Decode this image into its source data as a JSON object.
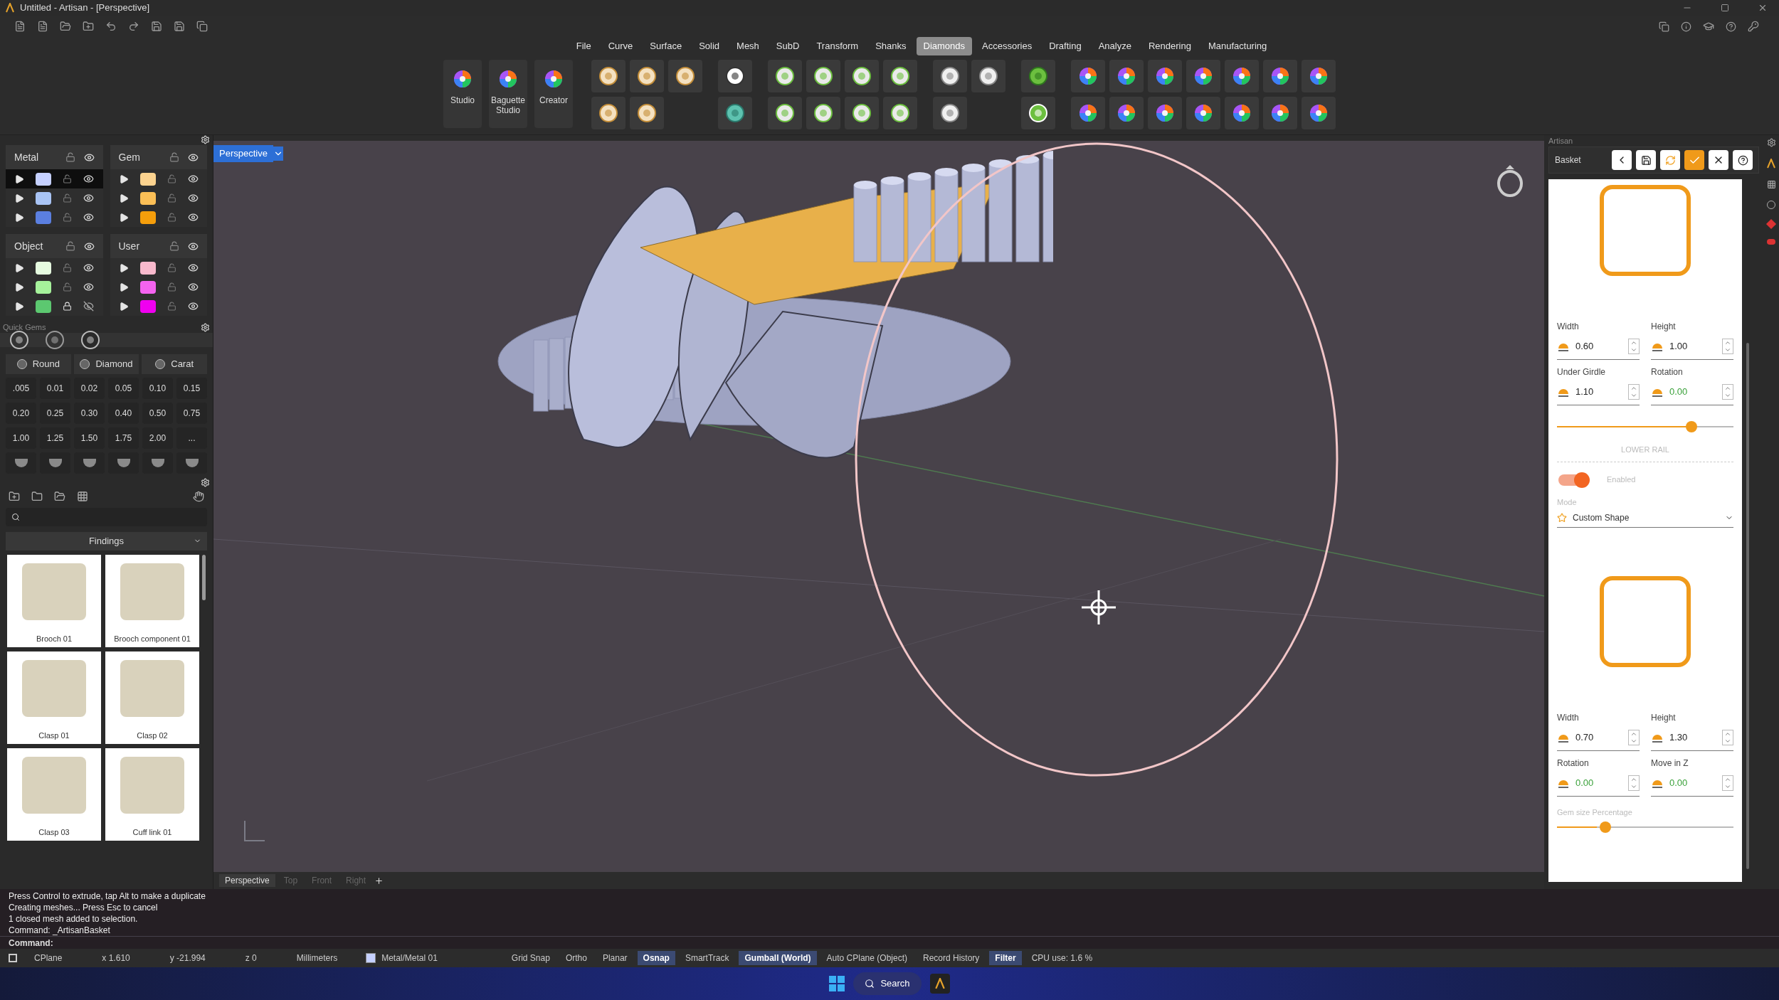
{
  "window": {
    "title": "Untitled - Artisan - [Perspective]"
  },
  "menu": [
    {
      "label": "File",
      "selected": false
    },
    {
      "label": "Curve",
      "selected": false
    },
    {
      "label": "Surface",
      "selected": false
    },
    {
      "label": "Solid",
      "selected": false
    },
    {
      "label": "Mesh",
      "selected": false
    },
    {
      "label": "SubD",
      "selected": false
    },
    {
      "label": "Transform",
      "selected": false
    },
    {
      "label": "Shanks",
      "selected": false
    },
    {
      "label": "Diamonds",
      "selected": true
    },
    {
      "label": "Accessories",
      "selected": false
    },
    {
      "label": "Drafting",
      "selected": false
    },
    {
      "label": "Analyze",
      "selected": false
    },
    {
      "label": "Rendering",
      "selected": false
    },
    {
      "label": "Manufacturing",
      "selected": false
    }
  ],
  "ribbon": {
    "studio_buttons": [
      "Studio",
      "Baguette Studio",
      "Creator"
    ]
  },
  "layers": [
    {
      "name": "Metal",
      "rows": [
        {
          "color": "#c5d0ff",
          "locked": false,
          "visible": true,
          "selected": true
        },
        {
          "color": "#a9c4f5",
          "locked": false,
          "visible": true,
          "selected": false
        },
        {
          "color": "#5b7fe0",
          "locked": false,
          "visible": true,
          "selected": false
        }
      ]
    },
    {
      "name": "Gem",
      "rows": [
        {
          "color": "#fcd38f",
          "locked": false,
          "visible": true,
          "selected": false
        },
        {
          "color": "#fbbf56",
          "locked": false,
          "visible": true,
          "selected": false
        },
        {
          "color": "#f59e0b",
          "locked": false,
          "visible": true,
          "selected": false
        }
      ]
    },
    {
      "name": "Object",
      "rows": [
        {
          "color": "#e6fbe0",
          "locked": false,
          "visible": true,
          "selected": false
        },
        {
          "color": "#a6f29b",
          "locked": false,
          "visible": true,
          "selected": false
        },
        {
          "color": "#5cc870",
          "locked": true,
          "visible": false,
          "selected": false
        }
      ]
    },
    {
      "name": "User",
      "rows": [
        {
          "color": "#f8b9cc",
          "locked": false,
          "visible": true,
          "selected": false
        },
        {
          "color": "#f463ef",
          "locked": false,
          "visible": true,
          "selected": false
        },
        {
          "color": "#f000f0",
          "locked": false,
          "visible": true,
          "selected": false
        }
      ]
    }
  ],
  "quick_gems": {
    "title": "Quick Gems",
    "dropdowns": [
      "Round",
      "Diamond",
      "Carat"
    ],
    "sizes": [
      ".005",
      "0.01",
      "0.02",
      "0.05",
      "0.10",
      "0.15",
      "0.20",
      "0.25",
      "0.30",
      "0.40",
      "0.50",
      "0.75",
      "1.00",
      "1.25",
      "1.50",
      "1.75",
      "2.00",
      "..."
    ]
  },
  "library": {
    "category": "Findings",
    "items": [
      {
        "label": "Brooch 01"
      },
      {
        "label": "Brooch component 01"
      },
      {
        "label": "Clasp 01"
      },
      {
        "label": "Clasp 02"
      },
      {
        "label": "Clasp 03"
      },
      {
        "label": "Cuff link 01"
      }
    ]
  },
  "viewport": {
    "label": "Perspective",
    "tabs": [
      {
        "label": "Perspective",
        "selected": true
      },
      {
        "label": "Top",
        "selected": false
      },
      {
        "label": "Front",
        "selected": false
      },
      {
        "label": "Right",
        "selected": false
      }
    ]
  },
  "artisan": {
    "title": "Artisan",
    "tool": "Basket",
    "upper_fields": [
      {
        "label": "Width",
        "value": "0.60",
        "changed": false
      },
      {
        "label": "Height",
        "value": "1.00",
        "changed": false
      },
      {
        "label": "Under Girdle",
        "value": "1.10",
        "changed": false
      },
      {
        "label": "Rotation",
        "value": "0.00",
        "changed": true
      }
    ],
    "upper_slider": {
      "level": 0.78
    },
    "section": "LOWER RAIL",
    "toggle": {
      "label": "Enabled",
      "on": true
    },
    "mode": {
      "label": "Mode",
      "value": "Custom Shape"
    },
    "lower_fields": [
      {
        "label": "Width",
        "value": "0.70",
        "changed": false
      },
      {
        "label": "Height",
        "value": "1.30",
        "changed": false
      },
      {
        "label": "Rotation",
        "value": "0.00",
        "changed": true
      },
      {
        "label": "Move in Z",
        "value": "0.00",
        "changed": true
      }
    ],
    "gem_size": {
      "label": "Gem size Percentage",
      "level": 0.26
    }
  },
  "command": {
    "history": [
      "Press Control to extrude, tap Alt to make a duplicate",
      "Creating meshes... Press Esc to cancel",
      "1 closed mesh added to selection.",
      "Command: _ArtisanBasket"
    ],
    "prompt": "Command:"
  },
  "status_bar": {
    "cplane": "CPlane",
    "coords": [
      "x 1.610",
      "y -21.994",
      "z 0"
    ],
    "units": "Millimeters",
    "layer": {
      "label": "Metal/Metal 01",
      "color": "#c5d0ff"
    },
    "toggles": [
      {
        "label": "Grid Snap",
        "selected": false
      },
      {
        "label": "Ortho",
        "selected": false
      },
      {
        "label": "Planar",
        "selected": false
      },
      {
        "label": "Osnap",
        "selected": true
      },
      {
        "label": "SmartTrack",
        "selected": false
      },
      {
        "label": "Gumball (World)",
        "selected": true
      },
      {
        "label": "Auto CPlane (Object)",
        "selected": false
      },
      {
        "label": "Record History",
        "selected": false
      },
      {
        "label": "Filter",
        "selected": true
      }
    ],
    "cpu": "CPU use: 1.6 %"
  },
  "taskbar": {
    "search": "Search"
  }
}
